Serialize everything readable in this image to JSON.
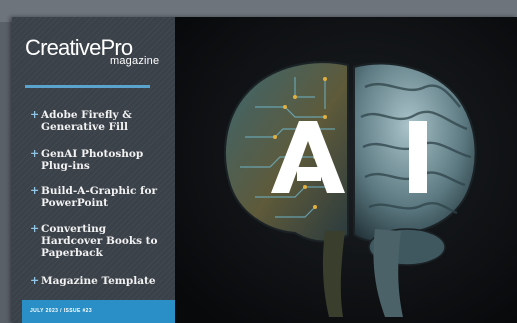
{
  "cover": {
    "brand_name": "CreativePro",
    "brand_suffix": "magazine",
    "headlines": [
      "Adobe Firefly & Generative Fill",
      "GenAI Photoshop Plug-ins",
      "Build-A-Graphic for PowerPoint",
      "Converting Hardcover Books to Paperback",
      "Magazine Template"
    ],
    "headline_bullet": "+",
    "issue_line": "JULY 2023  /  ISSUE #23",
    "hero_text": "AI",
    "colors": {
      "accent_blue": "#2a8fc6",
      "sidebar": "#3a4149",
      "background": "#0e0f12"
    },
    "hero_image": "brain-illustration (circuit left half, organic right half)"
  }
}
